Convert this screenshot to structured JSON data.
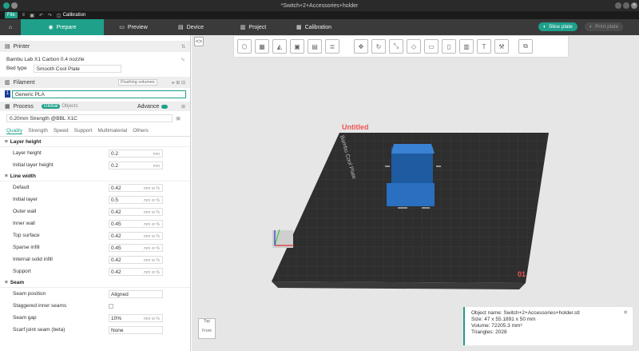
{
  "window": {
    "title": "*Switch+2+Accessories+holder",
    "close": "×"
  },
  "menu": {
    "file": "File",
    "plate": "Calibration"
  },
  "tabs": [
    {
      "label": "Prepare"
    },
    {
      "label": "Preview"
    },
    {
      "label": "Device"
    },
    {
      "label": "Project"
    },
    {
      "label": "Calibration"
    }
  ],
  "actions": {
    "slice": "Slice plate",
    "print": "Print plate"
  },
  "printer": {
    "section": "Printer",
    "name": "Bambu Lab X1 Carbon 0.4 nozzle",
    "bed_label": "Bed type",
    "bed_value": "Smooth Cool Plate"
  },
  "filament": {
    "section": "Filament",
    "flushing": "Flushing volumes",
    "slot": "1",
    "name": "Generic PLA"
  },
  "process": {
    "section": "Process",
    "global": "Global",
    "objects": "Objects",
    "advanced": "Advance",
    "preset": "0.20mm Strength @BBL X1C"
  },
  "qtabs": [
    "Quality",
    "Strength",
    "Speed",
    "Support",
    "Multimaterial",
    "Others"
  ],
  "groups": {
    "layer": "Layer height",
    "line": "Line width",
    "seam": "Seam"
  },
  "layer_params": [
    {
      "label": "Layer height",
      "value": "0.2",
      "unit": "mm"
    },
    {
      "label": "Initial layer height",
      "value": "0.2",
      "unit": "mm"
    }
  ],
  "line_params": [
    {
      "label": "Default",
      "value": "0.42",
      "unit": "mm or %"
    },
    {
      "label": "Initial layer",
      "value": "0.5",
      "unit": "mm or %"
    },
    {
      "label": "Outer wall",
      "value": "0.42",
      "unit": "mm or %"
    },
    {
      "label": "Inner wall",
      "value": "0.45",
      "unit": "mm or %"
    },
    {
      "label": "Top surface",
      "value": "0.42",
      "unit": "mm or %"
    },
    {
      "label": "Sparse infill",
      "value": "0.45",
      "unit": "mm or %"
    },
    {
      "label": "Internal solid infill",
      "value": "0.42",
      "unit": "mm or %"
    },
    {
      "label": "Support",
      "value": "0.42",
      "unit": "mm or %"
    }
  ],
  "seam_params": [
    {
      "label": "Seam position",
      "value": "Aligned"
    },
    {
      "label": "Staggered inner seams",
      "value": ""
    },
    {
      "label": "Seam gap",
      "value": "10%",
      "unit": "mm or %"
    },
    {
      "label": "Scarf joint seam (beta)",
      "value": "None"
    }
  ],
  "plate": {
    "name": "Untitled",
    "number": "01",
    "brand": "Bambu Cool Plate"
  },
  "object_info": {
    "name": "Object name: Switch+2+Accessories+holder.stl",
    "size": "Size: 47 x 55.1891 x 50 mm",
    "volume": "Volume: 72205.3 mm³",
    "triangles": "Triangles: 2028"
  },
  "view_cube": {
    "top": "Top",
    "front": "Front"
  }
}
